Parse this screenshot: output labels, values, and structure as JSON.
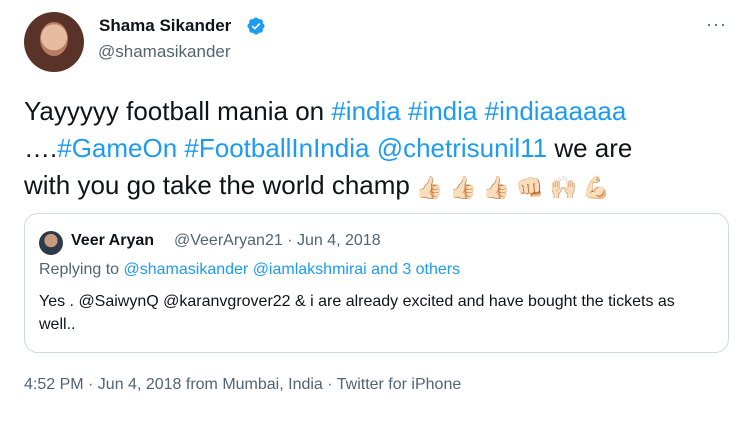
{
  "author": {
    "name": "Shama Sikander",
    "handle": "@shamasikander"
  },
  "tweet": {
    "line1": {
      "text": "Yayyyyy football mania on ",
      "tags": [
        "#india",
        "#india",
        "#indiaaaaaa"
      ]
    },
    "line2": {
      "prefix": "….",
      "tags": [
        "#GameOn",
        "#FootballInIndia",
        "@chetrisunil11"
      ],
      "suffix": " we are"
    },
    "line3": {
      "text": "with you go take the world champ"
    },
    "emojis": [
      "👍🏻",
      "👍🏻",
      "👍🏻",
      "👊🏻",
      "🙌🏻",
      "💪🏻"
    ]
  },
  "quoted": {
    "name": "Veer Aryan",
    "meta": "@VeerAryan21 · Jun 4, 2018",
    "reply_prefix": "Replying to ",
    "reply_to": "@shamasikander @iamlakshmirai and 3 others",
    "text": "Yes . @SaiwynQ @karanvgrover22 & i are already excited and have bought the tickets as well.."
  },
  "footer": "4:52 PM · Jun 4, 2018 from Mumbai, India · Twitter for iPhone",
  "colors": {
    "link": "#1d9bf0",
    "muted": "#536471",
    "text": "#0f1419",
    "border": "#cfd9de"
  }
}
